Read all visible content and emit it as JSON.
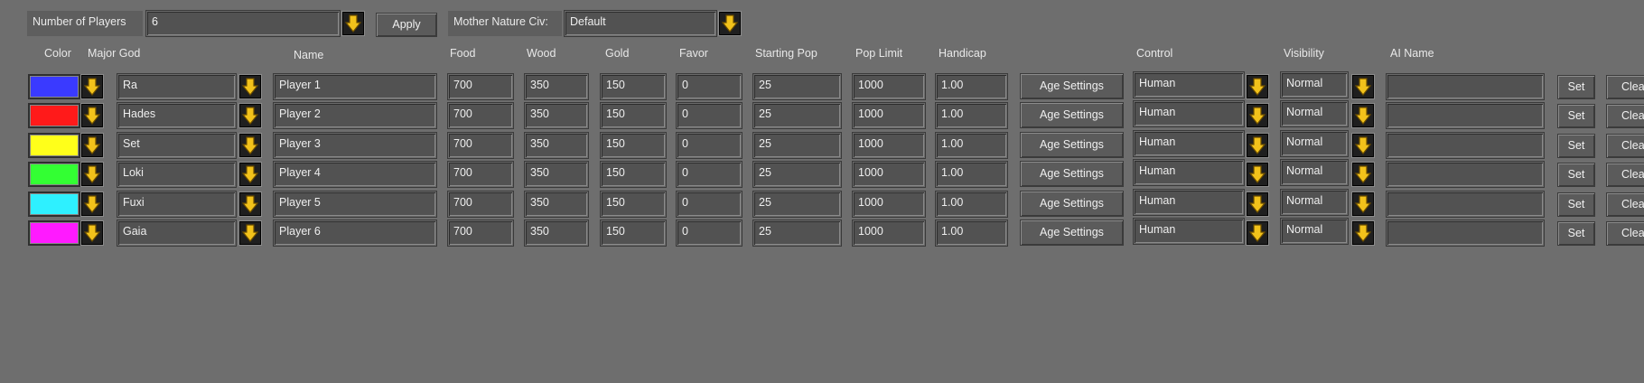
{
  "top_bar": {
    "num_players_label": "Number of Players",
    "num_players_value": "6",
    "apply_label": "Apply",
    "mother_nature_label": "Mother Nature Civ:",
    "mother_nature_value": "Default"
  },
  "headers": {
    "color": "Color",
    "major_god": "Major God",
    "name": "Name",
    "food": "Food",
    "wood": "Wood",
    "gold": "Gold",
    "favor": "Favor",
    "starting_pop": "Starting Pop",
    "pop_limit": "Pop Limit",
    "handicap": "Handicap",
    "control": "Control",
    "visibility": "Visibility",
    "ai_name": "AI Name"
  },
  "players": [
    {
      "color": "#3a3aff",
      "god": "Ra",
      "name": "Player 1",
      "food": "700",
      "wood": "350",
      "gold": "150",
      "favor": "0",
      "starting_pop": "25",
      "pop_limit": "1000",
      "handicap": "1.00",
      "age_settings": "Age Settings",
      "control": "Human",
      "visibility": "Normal",
      "ai_name": "",
      "set": "Set",
      "clear": "Clear"
    },
    {
      "color": "#ff1a1a",
      "god": "Hades",
      "name": "Player 2",
      "food": "700",
      "wood": "350",
      "gold": "150",
      "favor": "0",
      "starting_pop": "25",
      "pop_limit": "1000",
      "handicap": "1.00",
      "age_settings": "Age Settings",
      "control": "Human",
      "visibility": "Normal",
      "ai_name": "",
      "set": "Set",
      "clear": "Clear"
    },
    {
      "color": "#ffff1a",
      "god": "Set",
      "name": "Player 3",
      "food": "700",
      "wood": "350",
      "gold": "150",
      "favor": "0",
      "starting_pop": "25",
      "pop_limit": "1000",
      "handicap": "1.00",
      "age_settings": "Age Settings",
      "control": "Human",
      "visibility": "Normal",
      "ai_name": "",
      "set": "Set",
      "clear": "Clear"
    },
    {
      "color": "#33ff33",
      "god": "Loki",
      "name": "Player 4",
      "food": "700",
      "wood": "350",
      "gold": "150",
      "favor": "0",
      "starting_pop": "25",
      "pop_limit": "1000",
      "handicap": "1.00",
      "age_settings": "Age Settings",
      "control": "Human",
      "visibility": "Normal",
      "ai_name": "",
      "set": "Set",
      "clear": "Clear"
    },
    {
      "color": "#2ef0ff",
      "god": "Fuxi",
      "name": "Player 5",
      "food": "700",
      "wood": "350",
      "gold": "150",
      "favor": "0",
      "starting_pop": "25",
      "pop_limit": "1000",
      "handicap": "1.00",
      "age_settings": "Age Settings",
      "control": "Human",
      "visibility": "Normal",
      "ai_name": "",
      "set": "Set",
      "clear": "Clear"
    },
    {
      "color": "#ff1aff",
      "god": "Gaia",
      "name": "Player 6",
      "food": "700",
      "wood": "350",
      "gold": "150",
      "favor": "0",
      "starting_pop": "25",
      "pop_limit": "1000",
      "handicap": "1.00",
      "age_settings": "Age Settings",
      "control": "Human",
      "visibility": "Normal",
      "ai_name": "",
      "set": "Set",
      "clear": "Clear"
    }
  ],
  "icons": {
    "dropdown": "yellow-down-arrow-icon"
  }
}
